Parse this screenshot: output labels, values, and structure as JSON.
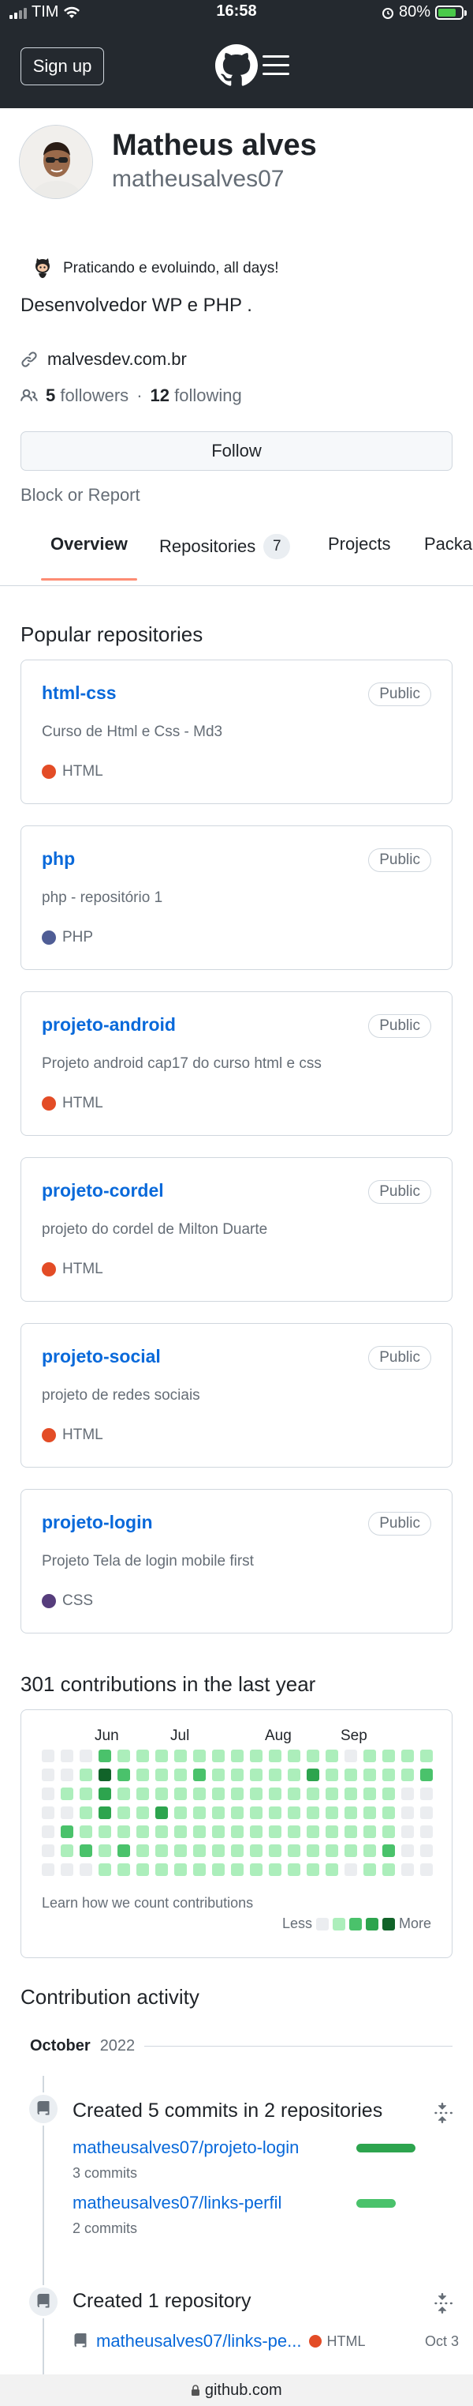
{
  "status_bar": {
    "carrier": "TIM",
    "time": "16:58",
    "battery": "80%",
    "battery_level": 0.8
  },
  "header": {
    "signup_label": "Sign up"
  },
  "profile": {
    "name": "Matheus alves",
    "username": "matheusalves07",
    "status": "Praticando e evoluindo, all days!",
    "bio": "Desenvolvedor WP e PHP .",
    "website": "malvesdev.com.br",
    "followers_count": "5",
    "followers_label": "followers",
    "separator": "·",
    "following_count": "12",
    "following_label": "following",
    "follow_label": "Follow",
    "block_label": "Block or Report"
  },
  "tabs": [
    {
      "label": "Overview"
    },
    {
      "label": "Repositories",
      "count": "7"
    },
    {
      "label": "Projects"
    },
    {
      "label": "Packa"
    }
  ],
  "popular": {
    "heading": "Popular repositories",
    "repos": [
      {
        "name": "html-css",
        "visibility": "Public",
        "description": "Curso de Html e Css - Md3",
        "language": "HTML",
        "color": "#e34c26"
      },
      {
        "name": "php",
        "visibility": "Public",
        "description": "php - repositório 1",
        "language": "PHP",
        "color": "#4F5D95"
      },
      {
        "name": "projeto-android",
        "visibility": "Public",
        "description": "Projeto android cap17 do curso html e css",
        "language": "HTML",
        "color": "#e34c26"
      },
      {
        "name": "projeto-cordel",
        "visibility": "Public",
        "description": "projeto do cordel de Milton Duarte",
        "language": "HTML",
        "color": "#e34c26"
      },
      {
        "name": "projeto-social",
        "visibility": "Public",
        "description": "projeto de redes sociais",
        "language": "HTML",
        "color": "#e34c26"
      },
      {
        "name": "projeto-login",
        "visibility": "Public",
        "description": "Projeto Tela de login mobile first",
        "language": "CSS",
        "color": "#563d7c"
      }
    ]
  },
  "contributions": {
    "heading": "301 contributions in the last year",
    "months": [
      "Jun",
      "Jul",
      "Aug",
      "Sep"
    ],
    "learn": "Learn how we count contributions",
    "less": "Less",
    "more": "More",
    "level_colors": [
      "#ebedf0",
      "#aceebb",
      "#4ac26b",
      "#2da44e",
      "#116329"
    ],
    "grid": [
      [
        0,
        0,
        0,
        2,
        1,
        1,
        1,
        1,
        1,
        1,
        1,
        1,
        1,
        1,
        1,
        1,
        0,
        1,
        1,
        1,
        1
      ],
      [
        0,
        0,
        1,
        4,
        2,
        1,
        1,
        1,
        2,
        1,
        1,
        1,
        1,
        1,
        3,
        1,
        1,
        1,
        1,
        1,
        2
      ],
      [
        0,
        1,
        1,
        3,
        1,
        1,
        1,
        1,
        1,
        1,
        1,
        1,
        1,
        1,
        1,
        1,
        1,
        1,
        1,
        0,
        0
      ],
      [
        0,
        0,
        1,
        3,
        1,
        1,
        3,
        1,
        1,
        1,
        1,
        1,
        1,
        1,
        1,
        1,
        1,
        1,
        1,
        0,
        0
      ],
      [
        0,
        2,
        1,
        1,
        1,
        1,
        1,
        1,
        1,
        1,
        1,
        1,
        1,
        1,
        1,
        1,
        1,
        1,
        1,
        0,
        0
      ],
      [
        0,
        1,
        2,
        1,
        2,
        1,
        1,
        1,
        1,
        1,
        1,
        1,
        1,
        1,
        1,
        1,
        1,
        1,
        2,
        0,
        0
      ],
      [
        0,
        0,
        0,
        1,
        1,
        1,
        1,
        1,
        1,
        1,
        1,
        1,
        1,
        1,
        1,
        1,
        0,
        1,
        1,
        0,
        0
      ]
    ]
  },
  "activity": {
    "heading": "Contribution activity",
    "month": "October",
    "year": "2022",
    "commits": {
      "title": "Created 5 commits in 2 repositories",
      "items": [
        {
          "repo": "matheusalves07/projeto-login",
          "count": "3 commits",
          "share": 0.6
        },
        {
          "repo": "matheusalves07/links-perfil",
          "count": "2 commits",
          "share": 0.4
        }
      ]
    },
    "created": {
      "title": "Created 1 repository",
      "repo": "matheusalves07/links-pe...",
      "language": "HTML",
      "color": "#e34c26",
      "date": "Oct 3"
    }
  },
  "browser": {
    "url": "github.com"
  }
}
